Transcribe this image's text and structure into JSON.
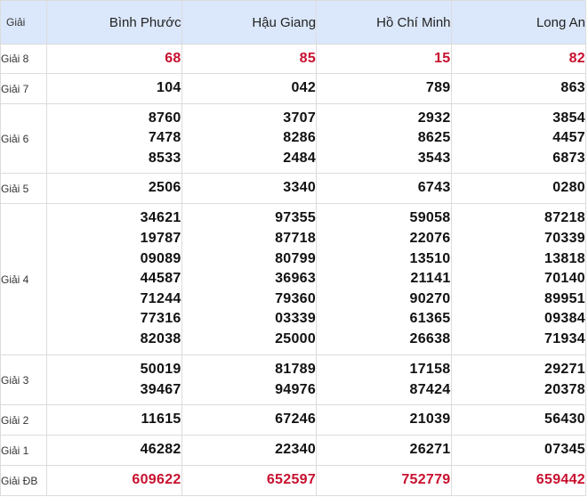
{
  "header": {
    "prize_label": "Giải",
    "provinces": [
      "Bình Phước",
      "Hậu Giang",
      "Hồ Chí Minh",
      "Long An"
    ]
  },
  "prizes": [
    {
      "label": "Giải 8",
      "values": [
        [
          "68"
        ],
        [
          "85"
        ],
        [
          "15"
        ],
        [
          "82"
        ]
      ]
    },
    {
      "label": "Giải 7",
      "values": [
        [
          "104"
        ],
        [
          "042"
        ],
        [
          "789"
        ],
        [
          "863"
        ]
      ]
    },
    {
      "label": "Giải 6",
      "values": [
        [
          "8760",
          "7478",
          "8533"
        ],
        [
          "3707",
          "8286",
          "2484"
        ],
        [
          "2932",
          "8625",
          "3543"
        ],
        [
          "3854",
          "4457",
          "6873"
        ]
      ]
    },
    {
      "label": "Giải 5",
      "values": [
        [
          "2506"
        ],
        [
          "3340"
        ],
        [
          "6743"
        ],
        [
          "0280"
        ]
      ]
    },
    {
      "label": "Giải 4",
      "values": [
        [
          "34621",
          "19787",
          "09089",
          "44587",
          "71244",
          "77316",
          "82038"
        ],
        [
          "97355",
          "87718",
          "80799",
          "36963",
          "79360",
          "03339",
          "25000"
        ],
        [
          "59058",
          "22076",
          "13510",
          "21141",
          "90270",
          "61365",
          "26638"
        ],
        [
          "87218",
          "70339",
          "13818",
          "70140",
          "89951",
          "09384",
          "71934"
        ]
      ]
    },
    {
      "label": "Giải 3",
      "values": [
        [
          "50019",
          "39467"
        ],
        [
          "81789",
          "94976"
        ],
        [
          "17158",
          "87424"
        ],
        [
          "29271",
          "20378"
        ]
      ]
    },
    {
      "label": "Giải 2",
      "values": [
        [
          "11615"
        ],
        [
          "67246"
        ],
        [
          "21039"
        ],
        [
          "56430"
        ]
      ]
    },
    {
      "label": "Giải 1",
      "values": [
        [
          "46282"
        ],
        [
          "22340"
        ],
        [
          "26271"
        ],
        [
          "07345"
        ]
      ]
    },
    {
      "label": "Giải ĐB",
      "values": [
        [
          "609622"
        ],
        [
          "652597"
        ],
        [
          "752779"
        ],
        [
          "659442"
        ]
      ]
    }
  ],
  "colors": {
    "header_bg": "#dbe7fb",
    "highlight": "#c8102e",
    "border": "#dcdcdc"
  }
}
